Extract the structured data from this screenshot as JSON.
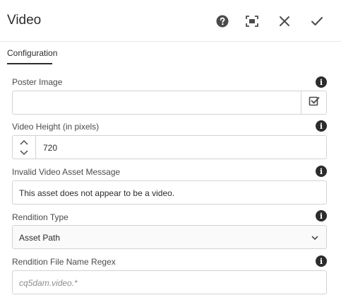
{
  "dialog": {
    "title": "Video",
    "help_icon": "help-circle-icon",
    "fullscreen_icon": "fullscreen-icon",
    "close_icon": "close-icon",
    "confirm_icon": "checkmark-icon"
  },
  "tabs": [
    {
      "label": "Configuration",
      "active": true
    }
  ],
  "fields": {
    "poster_image": {
      "label": "Poster Image",
      "value": "",
      "picker_icon": "select-check-icon"
    },
    "video_height": {
      "label": "Video Height (in pixels)",
      "value": "720"
    },
    "invalid_message": {
      "label": "Invalid Video Asset Message",
      "value": "This asset does not appear to be a video."
    },
    "rendition_type": {
      "label": "Rendition Type",
      "value": "Asset Path"
    },
    "rendition_regex": {
      "label": "Rendition File Name Regex",
      "value": "",
      "placeholder": "cq5dam.video.*"
    }
  },
  "info_icon_glyph": "i",
  "colors": {
    "text": "#2c2c2c",
    "border": "#d3d3d3",
    "label": "#4b4b4b"
  }
}
